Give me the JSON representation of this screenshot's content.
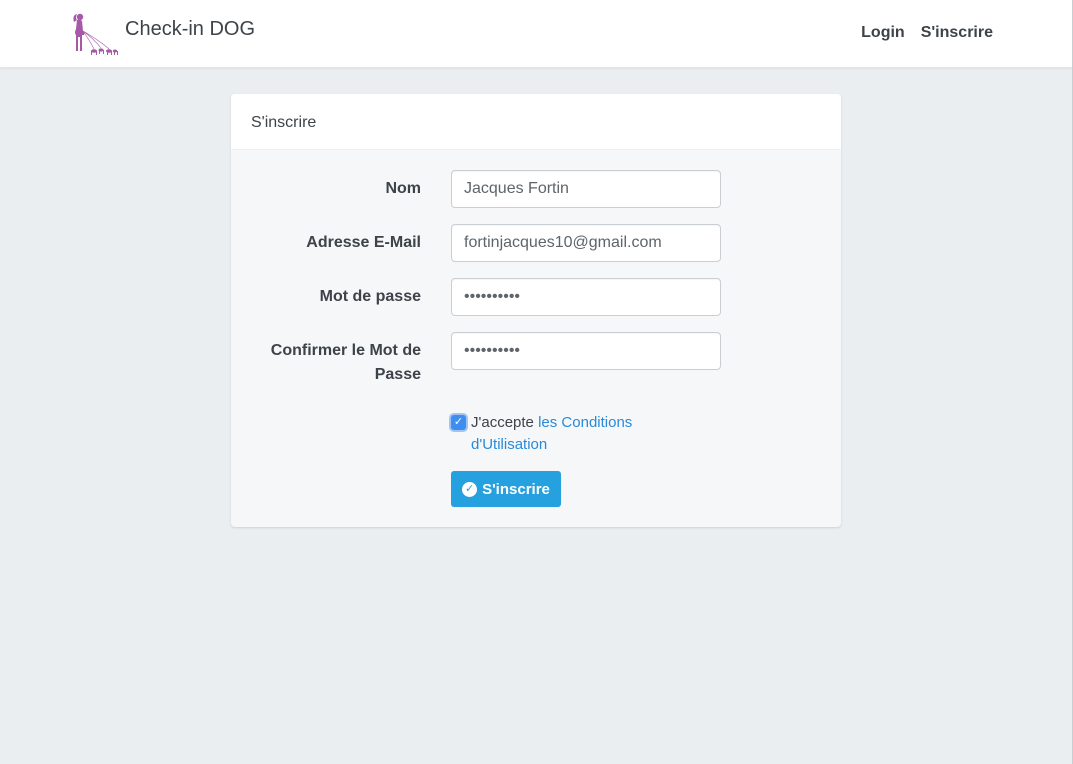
{
  "header": {
    "brand": "Check-in DOG",
    "nav": {
      "login": "Login",
      "register": "S'inscrire"
    }
  },
  "card": {
    "title": "S'inscrire",
    "fields": {
      "name": {
        "label": "Nom",
        "value": "Jacques Fortin"
      },
      "email": {
        "label": "Adresse E-Mail",
        "value": "fortinjacques10@gmail.com"
      },
      "password": {
        "label": "Mot de passe",
        "value": "••••••••••"
      },
      "confirm": {
        "label": "Confirmer le Mot de Passe",
        "value": "••••••••••"
      }
    },
    "terms": {
      "prefix": "J'accepte ",
      "link": "les Conditions d'Utilisation",
      "checked": true
    },
    "submit_label": "S'inscrire"
  },
  "colors": {
    "accent": "#26a1e0",
    "link": "#2a8ad8",
    "logo": "#a559a6",
    "background": "#ebeef1"
  },
  "icons": {
    "logo": "woman-walking-dogs-logo",
    "checkbox": "checkmark-icon",
    "button": "check-circle-icon"
  }
}
